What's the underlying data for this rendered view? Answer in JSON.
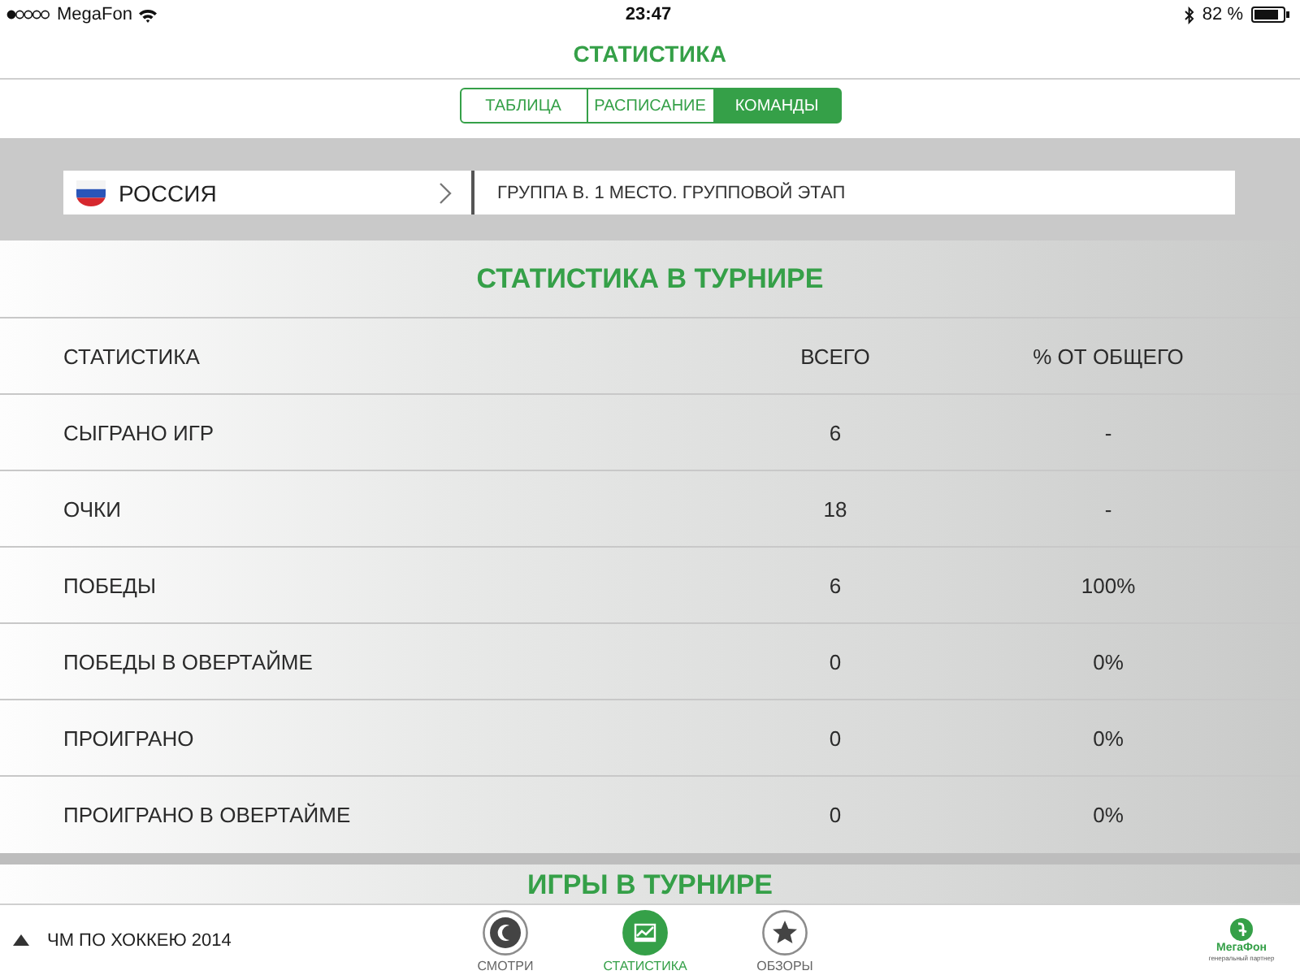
{
  "status_bar": {
    "carrier": "MegaFon",
    "time": "23:47",
    "battery": "82 %"
  },
  "header": {
    "title": "СТАТИСТИКА"
  },
  "segments": [
    {
      "label": "ТАБЛИЦА",
      "selected": false
    },
    {
      "label": "РАСПИСАНИЕ",
      "selected": false
    },
    {
      "label": "КОМАНДЫ",
      "selected": true
    }
  ],
  "team_bar": {
    "team": "РОССИЯ",
    "info": "ГРУППА В. 1 МЕСТО. ГРУППОВОЙ ЭТАП"
  },
  "stats_section": {
    "title": "СТАТИСТИКА В ТУРНИРЕ",
    "columns": [
      "СТАТИСТИКА",
      "ВСЕГО",
      "% ОТ ОБЩЕГО"
    ],
    "rows": [
      [
        "СЫГРАНО ИГР",
        "6",
        "-"
      ],
      [
        "ОЧКИ",
        "18",
        "-"
      ],
      [
        "ПОБЕДЫ",
        "6",
        "100%"
      ],
      [
        "ПОБЕДЫ В ОВЕРТАЙМЕ",
        "0",
        "0%"
      ],
      [
        "ПРОИГРАНО",
        "0",
        "0%"
      ],
      [
        "ПРОИГРАНО В ОВЕРТАЙМЕ",
        "0",
        "0%"
      ]
    ]
  },
  "next_section": {
    "title": "ИГРЫ В ТУРНИРЕ"
  },
  "bottom_bar": {
    "label": "ЧМ ПО ХОККЕЮ 2014",
    "tabs": [
      {
        "label": "СМОТРИ",
        "kind": "watch",
        "selected": false
      },
      {
        "label": "СТАТИСТИКА",
        "kind": "stats",
        "selected": true
      },
      {
        "label": "ОБЗОРЫ",
        "kind": "reviews",
        "selected": false
      }
    ],
    "partner": {
      "name": "МегаФон",
      "caption": "генеральный партнер"
    }
  }
}
